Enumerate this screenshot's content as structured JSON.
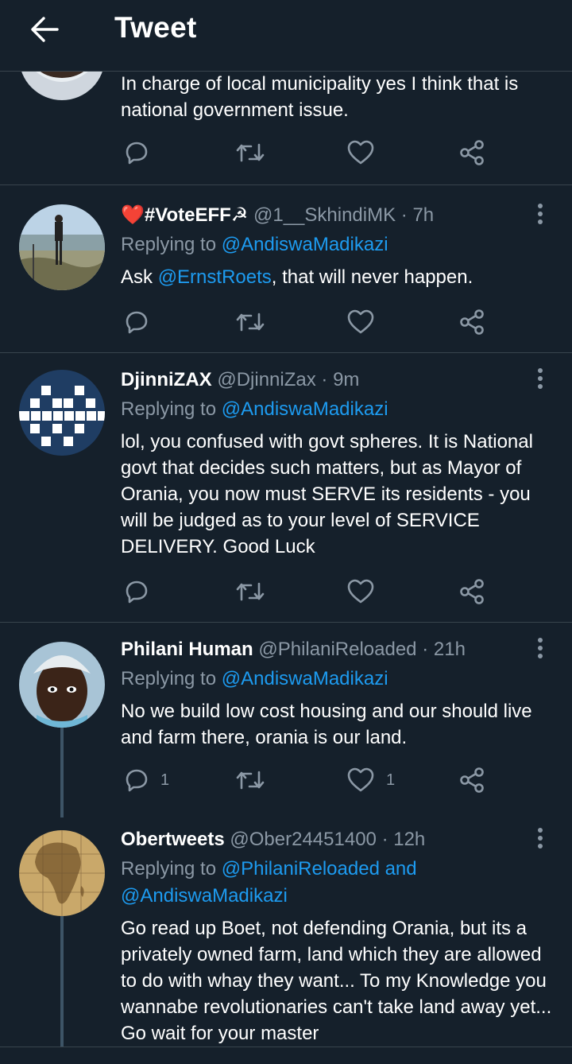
{
  "header": {
    "title": "Tweet"
  },
  "tweet_partial": {
    "text": "In charge of local municipality yes I think that is national government issue."
  },
  "tweets": [
    {
      "name": "❤️#VoteEFF☭",
      "handle": "@1__SkhindiMK",
      "time": "7h",
      "reply_prefix": "Replying to ",
      "reply_to": "@AndiswaMadikazi",
      "text_mention": "@ErnstRoets",
      "text_before": "Ask ",
      "text_after": ", that will never happen."
    },
    {
      "name": "DjinniZAX",
      "handle": "@DjinniZax",
      "time": "9m",
      "reply_prefix": "Replying to ",
      "reply_to": "@AndiswaMadikazi",
      "text": "lol, you confused with govt spheres. It is National govt that decides such matters, but as Mayor of Orania, you now must SERVE its residents - you will be judged as to your level of SERVICE DELIVERY. Good Luck"
    },
    {
      "name": "Philani Human",
      "handle": "@PhilaniReloaded",
      "time": "21h",
      "reply_prefix": "Replying to ",
      "reply_to": "@AndiswaMadikazi",
      "text": "No we build low cost housing and our should live and farm there, orania is our land.",
      "reply_count": "1",
      "like_count": "1"
    },
    {
      "name": "Obertweets",
      "handle": "@Ober24451400",
      "time": "12h",
      "reply_prefix": "Replying to ",
      "reply_to_line1": "@PhilaniReloaded and",
      "reply_to_line2": "@AndiswaMadikazi",
      "text": "Go read up Boet, not defending Orania, but its a privately owned farm, land which they are allowed to do with whay they want... To my Knowledge you wannabe revolutionaries can't take land away yet... Go wait for your master"
    }
  ],
  "sep": "·",
  "colors": {
    "background": "#15202b",
    "accent": "#1d9bf0",
    "muted": "#8b98a5",
    "divider": "#38444d"
  }
}
